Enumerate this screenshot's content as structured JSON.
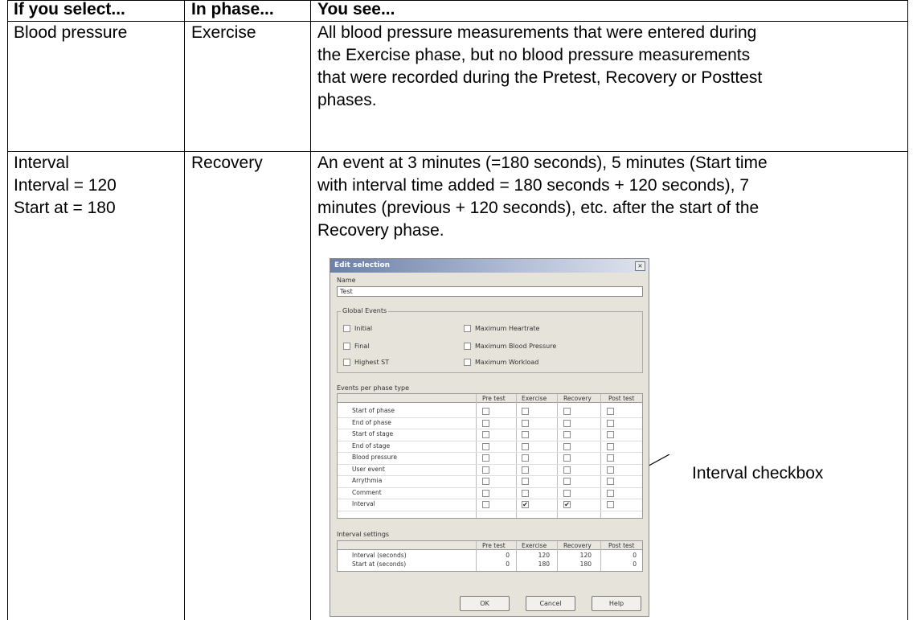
{
  "table": {
    "headers": [
      "If you select...",
      "In phase...",
      "You see..."
    ],
    "row1": {
      "select": "Blood pressure",
      "phase": "Exercise",
      "description_lines": [
        "All blood pressure measurements that were entered during",
        "the Exercise phase, but no blood pressure measurements",
        "that were recorded during the Pretest, Recovery or Posttest",
        "phases."
      ]
    },
    "row2": {
      "select_lines": [
        "Interval",
        "Interval = 120",
        "Start at = 180"
      ],
      "phase": "Recovery",
      "description_lines": [
        "An event at 3 minutes (=180 seconds), 5 minutes (Start time",
        "with interval time added = 180 seconds + 120 seconds), 7",
        "minutes (previous + 120 seconds), etc. after the start of the",
        "Recovery phase."
      ]
    }
  },
  "callout": {
    "label": "Interval checkbox"
  },
  "dialog": {
    "title": "Edit selection",
    "close_glyph": "×",
    "name_label": "Name",
    "name_value": "Test",
    "global_events": {
      "label": "Global Events",
      "items": [
        {
          "label": "Initial",
          "checked": false
        },
        {
          "label": "Maximum Heartrate",
          "checked": false
        },
        {
          "label": "Final",
          "checked": false
        },
        {
          "label": "Maximum Blood Pressure",
          "checked": false
        },
        {
          "label": "Highest ST",
          "checked": false
        },
        {
          "label": "Maximum Workload",
          "checked": false
        }
      ]
    },
    "events_per_phase": {
      "label": "Events per phase type",
      "columns": [
        "Pre test",
        "Exercise",
        "Recovery",
        "Post test"
      ],
      "rows": [
        {
          "label": "Start of phase",
          "checked": [
            false,
            false,
            false,
            false
          ]
        },
        {
          "label": "End of phase",
          "checked": [
            false,
            false,
            false,
            false
          ]
        },
        {
          "label": "Start of stage",
          "checked": [
            false,
            false,
            false,
            false
          ]
        },
        {
          "label": "End of stage",
          "checked": [
            false,
            false,
            false,
            false
          ]
        },
        {
          "label": "Blood pressure",
          "checked": [
            false,
            false,
            false,
            false
          ]
        },
        {
          "label": "User event",
          "checked": [
            false,
            false,
            false,
            false
          ]
        },
        {
          "label": "Arrythmia",
          "checked": [
            false,
            false,
            false,
            false
          ]
        },
        {
          "label": "Comment",
          "checked": [
            false,
            false,
            false,
            false
          ]
        },
        {
          "label": "Interval",
          "checked": [
            false,
            true,
            true,
            false
          ]
        }
      ]
    },
    "interval_settings": {
      "label": "Interval settings",
      "columns": [
        "Pre test",
        "Exercise",
        "Recovery",
        "Post test"
      ],
      "rows": [
        {
          "label": "Interval (seconds)",
          "values": [
            "0",
            "120",
            "120",
            "0"
          ]
        },
        {
          "label": "Start at (seconds)",
          "values": [
            "0",
            "180",
            "180",
            "0"
          ]
        }
      ]
    },
    "buttons": {
      "ok": "OK",
      "cancel": "Cancel",
      "help": "Help"
    },
    "check_glyph": "✔"
  }
}
